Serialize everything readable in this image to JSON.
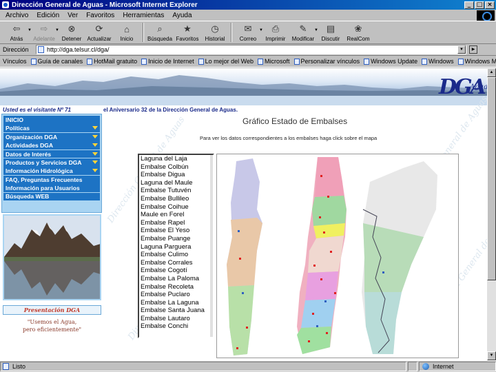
{
  "window": {
    "title": "Dirección General de Aguas - Microsoft Internet Explorer",
    "btn_min": "_",
    "btn_max": "□",
    "btn_close": "×"
  },
  "menu": [
    "Archivo",
    "Edición",
    "Ver",
    "Favoritos",
    "Herramientas",
    "Ayuda"
  ],
  "toolbar": [
    {
      "label": "Atrás",
      "icon": "back-arrow-icon",
      "glyph": "⇦",
      "disabled": false,
      "dropdown": true
    },
    {
      "label": "Adelante",
      "icon": "forward-arrow-icon",
      "glyph": "⇨",
      "disabled": true,
      "dropdown": true
    },
    {
      "label": "Detener",
      "icon": "stop-icon",
      "glyph": "⊗",
      "disabled": false,
      "dropdown": false
    },
    {
      "label": "Actualizar",
      "icon": "refresh-icon",
      "glyph": "⟳",
      "disabled": false,
      "dropdown": false
    },
    {
      "label": "Inicio",
      "icon": "home-icon",
      "glyph": "⌂",
      "disabled": false,
      "dropdown": false
    },
    {
      "label": "Búsqueda",
      "icon": "search-icon",
      "glyph": "⌕",
      "disabled": false,
      "dropdown": false
    },
    {
      "label": "Favoritos",
      "icon": "favorites-icon",
      "glyph": "★",
      "disabled": false,
      "dropdown": false
    },
    {
      "label": "Historial",
      "icon": "history-icon",
      "glyph": "◷",
      "disabled": false,
      "dropdown": false
    },
    {
      "label": "Correo",
      "icon": "mail-icon",
      "glyph": "✉",
      "disabled": false,
      "dropdown": true
    },
    {
      "label": "Imprimir",
      "icon": "print-icon",
      "glyph": "⎙",
      "disabled": false,
      "dropdown": false
    },
    {
      "label": "Modificar",
      "icon": "edit-icon",
      "glyph": "✎",
      "disabled": false,
      "dropdown": true
    },
    {
      "label": "Discutir",
      "icon": "discuss-icon",
      "glyph": "▤",
      "disabled": false,
      "dropdown": false
    },
    {
      "label": "RealCom",
      "icon": "messenger-icon",
      "glyph": "❀",
      "disabled": false,
      "dropdown": false
    }
  ],
  "address": {
    "label": "Dirección",
    "value": "http://dga.telsur.cl/dga/"
  },
  "links": {
    "label": "Vínculos",
    "items": [
      "Guía de canales",
      "HotMail gratuito",
      "Inicio de Internet",
      "Lo mejor del Web",
      "Microsoft",
      "Personalizar vínculos",
      "Windows Update",
      "Windows",
      "Windows Media"
    ]
  },
  "page": {
    "logo": "DGA",
    "logo_sub": "Aguas",
    "visitor": "Usted es el visitante Nº 71",
    "marquee": "el Aniversario 32 de la Dirección General de Aguas.",
    "nav": [
      {
        "label": "INICIO",
        "arrow": false
      },
      {
        "label": "Políticas",
        "arrow": true
      },
      {
        "label": "Organización DGA",
        "arrow": true
      },
      {
        "label": "Actividades DGA",
        "arrow": true
      },
      {
        "label": "Datos de Interés",
        "arrow": true
      },
      {
        "label": "Productos y Servicios DGA",
        "arrow": true
      },
      {
        "label": "Información Hidrológica",
        "arrow": true
      },
      {
        "label": "FAQ, Preguntas Frecuentes",
        "arrow": false
      },
      {
        "label": "Información para Usuarios",
        "arrow": false
      },
      {
        "label": "Búsqueda WEB",
        "arrow": false
      }
    ],
    "presentacion": "Presentación DGA",
    "slogan_1": "\"Usemos el Agua,",
    "slogan_2": "pero eficientemente\"",
    "watermark": "Dirección General de Aguas",
    "main_title": "Gráfico Estado de Embalses",
    "main_sub": "Para ver los datos correspondientes a los embalses haga click sobre el mapa",
    "dams": [
      "Laguna del Laja",
      "Embalse Colbún",
      "Embalse Digua",
      "Laguna del Maule",
      "Embalse Tutuvén",
      "Embalse Bullileo",
      "Embalse Coihue",
      "Maule en Forel",
      "Embalse Rapel",
      "Embalse El Yeso",
      "Embalse Puange",
      "Laguna Parguera",
      "Embalse Culimo",
      "Embalse Corrales",
      "Embalse Cogotí",
      "Embalse La Paloma",
      "Embalse Recoleta",
      "Embalse Puclaro",
      "Embalse La Laguna",
      "Embalse Santa Juana",
      "Embalse Lautaro",
      "Embalse Conchi"
    ]
  },
  "status": {
    "left": "Listo",
    "zone": "Internet"
  }
}
